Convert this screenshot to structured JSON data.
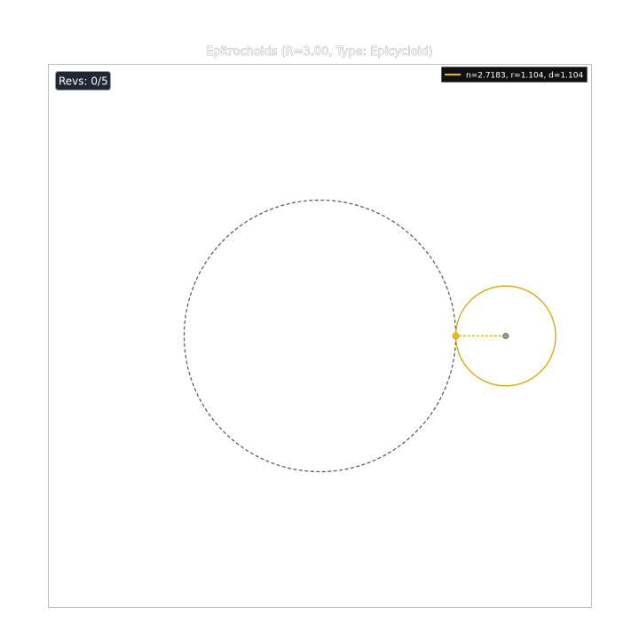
{
  "title": "Epitrochoids (R=3.00, Type: Epicycloid)",
  "revs_label": "Revs: 0/5",
  "legend": {
    "entries": [
      {
        "label": "n=2.7183, r=1.104, d=1.104",
        "color": "#f0c000"
      }
    ]
  },
  "colors": {
    "frame": "#bdbdbd",
    "fixed_circle": "#555555",
    "rolling_circle": "#d4a800",
    "legend_bg": "#111111",
    "revs_bg": "#1f2733",
    "pen_dot": "#f0c000",
    "center_dot": "#9a9a9a"
  },
  "chart_data": {
    "type": "line",
    "title": "Epitrochoids (R=3.00, Type: Epicycloid)",
    "xlabel": "",
    "ylabel": "",
    "grid": false,
    "legend_position": "top-right",
    "xlim": [
      -6,
      6
    ],
    "ylim": [
      -6,
      6
    ],
    "fixed_circle": {
      "center": [
        0,
        0
      ],
      "radius": 3.0
    },
    "rolling_circle": {
      "center": [
        4.104,
        0
      ],
      "radius": 1.104
    },
    "pen": {
      "point": [
        3.0,
        0
      ],
      "arm_length": 1.104
    },
    "series": [
      {
        "name": "n=2.7183, r=1.104, d=1.104",
        "n": 2.7183,
        "r": 1.104,
        "d": 1.104
      }
    ],
    "revolutions": {
      "current": 0,
      "total": 5
    }
  }
}
